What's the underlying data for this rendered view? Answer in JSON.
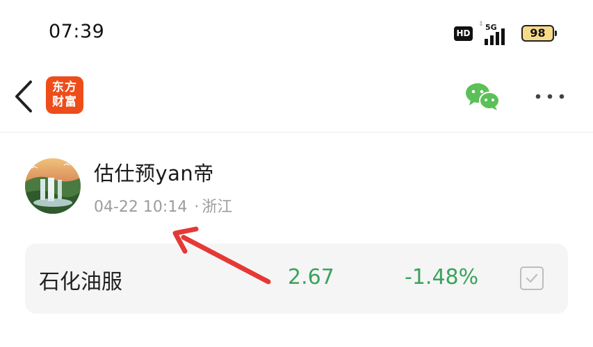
{
  "status_bar": {
    "time": "07:39",
    "hd_badge": "HD",
    "network": "5G",
    "battery": "98"
  },
  "nav": {
    "app_logo_line1": "东方",
    "app_logo_line2": "财富",
    "icons": [
      "back-chevron-icon",
      "wechat-icon",
      "more-icon"
    ],
    "colors": {
      "logo_bg": "#ee4d1a",
      "wechat": "#5bc057"
    }
  },
  "post": {
    "username": "估仕预yan帝",
    "timestamp": "04-22 10:14",
    "separator": "·",
    "location": "浙江"
  },
  "stock": {
    "name": "石化油服",
    "price": "2.67",
    "change": "-1.48%",
    "colors": {
      "price": "#3aa35a"
    }
  },
  "annotation": {
    "type": "red-arrow",
    "color": "#e53935"
  }
}
